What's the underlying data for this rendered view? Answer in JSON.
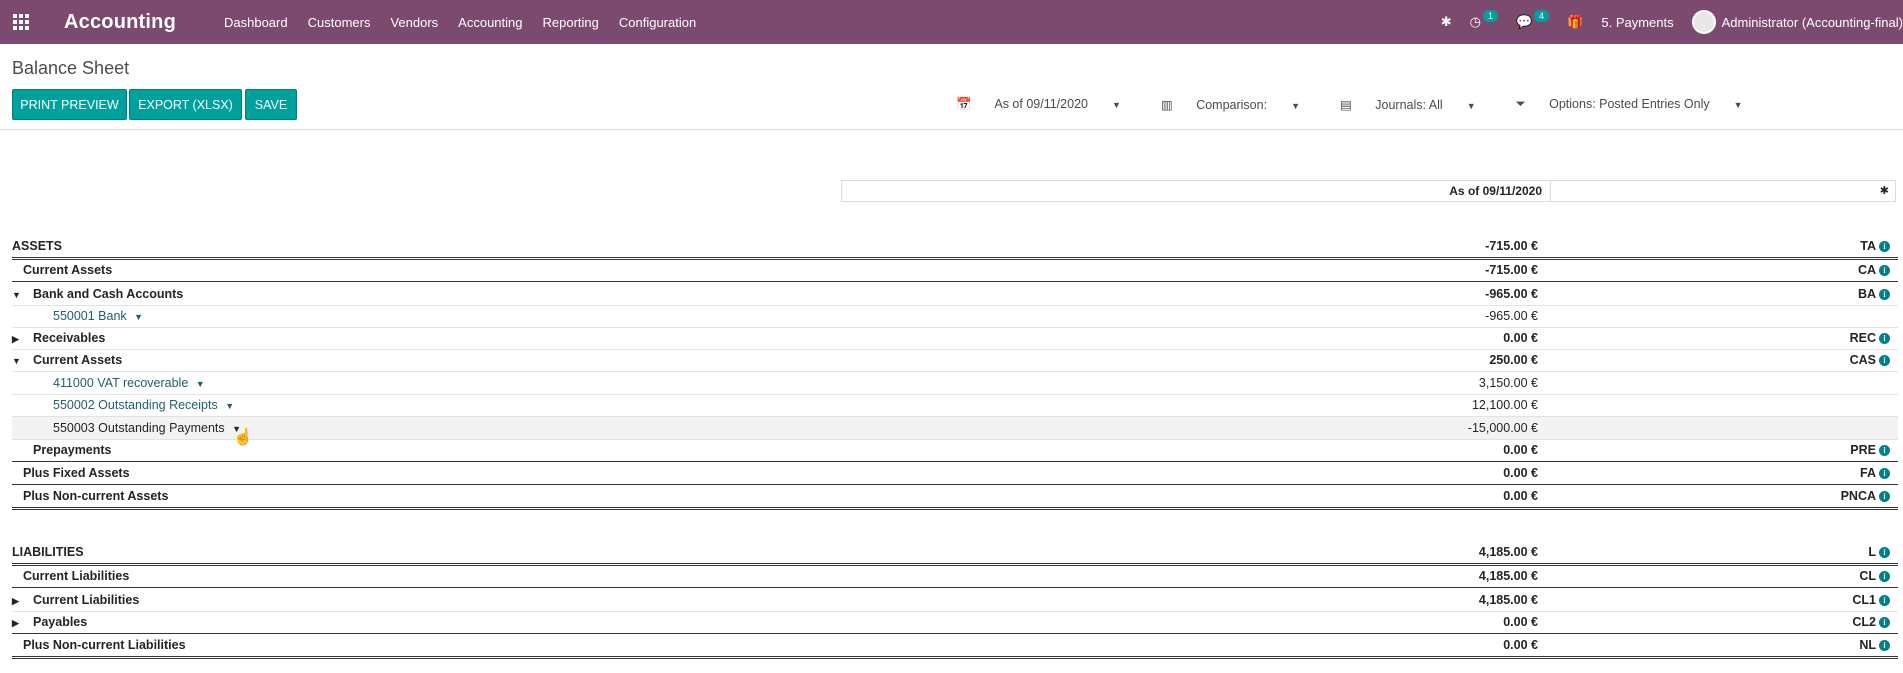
{
  "nav": {
    "brand": "Accounting",
    "menu": [
      "Dashboard",
      "Customers",
      "Vendors",
      "Accounting",
      "Reporting",
      "Configuration"
    ],
    "activity_badge": "1",
    "messages_badge": "4",
    "company": "5. Payments",
    "user": "Administrator (Accounting-final)"
  },
  "page": {
    "title": "Balance Sheet",
    "buttons": {
      "print": "PRINT PREVIEW",
      "export": "EXPORT (XLSX)",
      "save": "SAVE"
    },
    "filters": {
      "date": "As of 09/11/2020",
      "comparison": "Comparison:",
      "journals": "Journals: All",
      "options": "Options: Posted Entries Only"
    }
  },
  "report": {
    "column_header": "As of 09/11/2020",
    "rows": [
      {
        "label": "ASSETS",
        "value": "-715.00 €",
        "code": "TA"
      },
      {
        "label": "Current Assets",
        "value": "-715.00 €",
        "code": "CA"
      },
      {
        "label": "Bank and Cash Accounts",
        "value": "-965.00 €",
        "code": "BA"
      },
      {
        "label": "550001 Bank",
        "value": "-965.00 €",
        "code": ""
      },
      {
        "label": "Receivables",
        "value": "0.00 €",
        "code": "REC"
      },
      {
        "label": "Current Assets",
        "value": "250.00 €",
        "code": "CAS"
      },
      {
        "label": "411000 VAT recoverable",
        "value": "3,150.00 €",
        "code": ""
      },
      {
        "label": "550002 Outstanding Receipts",
        "value": "12,100.00 €",
        "code": ""
      },
      {
        "label": "550003 Outstanding Payments",
        "value": "-15,000.00 €",
        "code": ""
      },
      {
        "label": "Prepayments",
        "value": "0.00 €",
        "code": "PRE"
      },
      {
        "label": "Plus Fixed Assets",
        "value": "0.00 €",
        "code": "FA"
      },
      {
        "label": "Plus Non-current Assets",
        "value": "0.00 €",
        "code": "PNCA"
      },
      {
        "label": "LIABILITIES",
        "value": "4,185.00 €",
        "code": "L"
      },
      {
        "label": "Current Liabilities",
        "value": "4,185.00 €",
        "code": "CL"
      },
      {
        "label": "Current Liabilities",
        "value": "4,185.00 €",
        "code": "CL1"
      },
      {
        "label": "Payables",
        "value": "0.00 €",
        "code": "CL2"
      },
      {
        "label": "Plus Non-current Liabilities",
        "value": "0.00 €",
        "code": "NL"
      }
    ]
  }
}
